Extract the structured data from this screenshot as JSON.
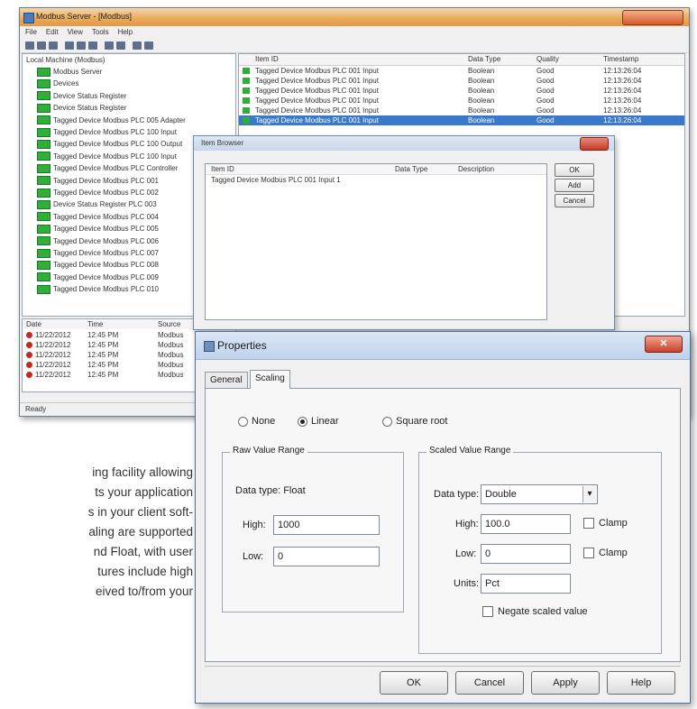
{
  "main_window": {
    "title": "Modbus Server - [Modbus]",
    "menu": [
      "File",
      "Edit",
      "View",
      "Tools",
      "Help"
    ],
    "tree_root": "Local Machine (Modbus)",
    "tree_items": [
      "Modbus Server",
      "Devices",
      "Device Status Register",
      "Device Status Register",
      "Tagged Device Modbus PLC 005 Adapter",
      "Tagged Device Modbus PLC 100 Input",
      "Tagged Device Modbus PLC 100 Output",
      "Tagged Device Modbus PLC 100 Input",
      "Tagged Device Modbus PLC Controller",
      "Tagged Device Modbus PLC 001",
      "Tagged Device Modbus PLC 002",
      "Device Status Register PLC 003",
      "Tagged Device Modbus PLC 004",
      "Tagged Device Modbus PLC 005",
      "Tagged Device Modbus PLC 006",
      "Tagged Device Modbus PLC 007",
      "Tagged Device Modbus PLC 008",
      "Tagged Device Modbus PLC 009",
      "Tagged Device Modbus PLC 010"
    ],
    "grid_headers": [
      "Item ID",
      "Data Type",
      "Quality",
      "Timestamp"
    ],
    "grid_rows": [
      {
        "id": "Tagged Device Modbus PLC 001 Input",
        "type": "Boolean",
        "q": "Good",
        "ts": "12:13:26:04"
      },
      {
        "id": "Tagged Device Modbus PLC 001 Input",
        "type": "Boolean",
        "q": "Good",
        "ts": "12:13:26:04"
      },
      {
        "id": "Tagged Device Modbus PLC 001 Input",
        "type": "Boolean",
        "q": "Good",
        "ts": "12:13:26:04"
      },
      {
        "id": "Tagged Device Modbus PLC 001 Input",
        "type": "Boolean",
        "q": "Good",
        "ts": "12:13:26:04"
      },
      {
        "id": "Tagged Device Modbus PLC 001 Input",
        "type": "Boolean",
        "q": "Good",
        "ts": "12:13:26:04"
      },
      {
        "id": "Tagged Device Modbus PLC 001 Input",
        "type": "Boolean",
        "q": "Good",
        "ts": "12:13:26:04"
      }
    ],
    "log_headers": [
      "Date",
      "Time",
      "Source"
    ],
    "log_rows": [
      {
        "d": "11/22/2012",
        "t": "12:45 PM",
        "s": "Modbus"
      },
      {
        "d": "11/22/2012",
        "t": "12:45 PM",
        "s": "Modbus"
      },
      {
        "d": "11/22/2012",
        "t": "12:45 PM",
        "s": "Modbus"
      },
      {
        "d": "11/22/2012",
        "t": "12:45 PM",
        "s": "Modbus"
      },
      {
        "d": "11/22/2012",
        "t": "12:45 PM",
        "s": "Modbus"
      }
    ],
    "status": "Ready"
  },
  "middle_dialog": {
    "title": "Item Browser",
    "headers": [
      "Item ID",
      "Data Type",
      "Description"
    ],
    "row": "Tagged Device Modbus PLC 001 Input 1",
    "buttons": [
      "OK",
      "Add",
      "Cancel"
    ]
  },
  "properties": {
    "title": "Properties",
    "tabs": [
      "General",
      "Scaling"
    ],
    "radio_none": "None",
    "radio_linear": "Linear",
    "radio_sqroot": "Square root",
    "raw_group": "Raw Value Range",
    "raw_type_label": "Data type: Float",
    "raw_high_label": "High:",
    "raw_high_value": "1000",
    "raw_low_label": "Low:",
    "raw_low_value": "0",
    "scaled_group": "Scaled Value Range",
    "scaled_type_label": "Data type:",
    "scaled_type_value": "Double",
    "scaled_high_label": "High:",
    "scaled_high_value": "100.0",
    "scaled_low_label": "Low:",
    "scaled_low_value": "0",
    "units_label": "Units:",
    "units_value": "Pct",
    "clamp_label": "Clamp",
    "negate_label": "Negate scaled value",
    "buttons": {
      "ok": "OK",
      "cancel": "Cancel",
      "apply": "Apply",
      "help": "Help"
    }
  },
  "paragraph": [
    "ing facility allowing",
    "ts your application",
    "s in your client soft-",
    "aling are supported",
    "nd Float, with user",
    "tures  include  high",
    "eived to/from your"
  ]
}
